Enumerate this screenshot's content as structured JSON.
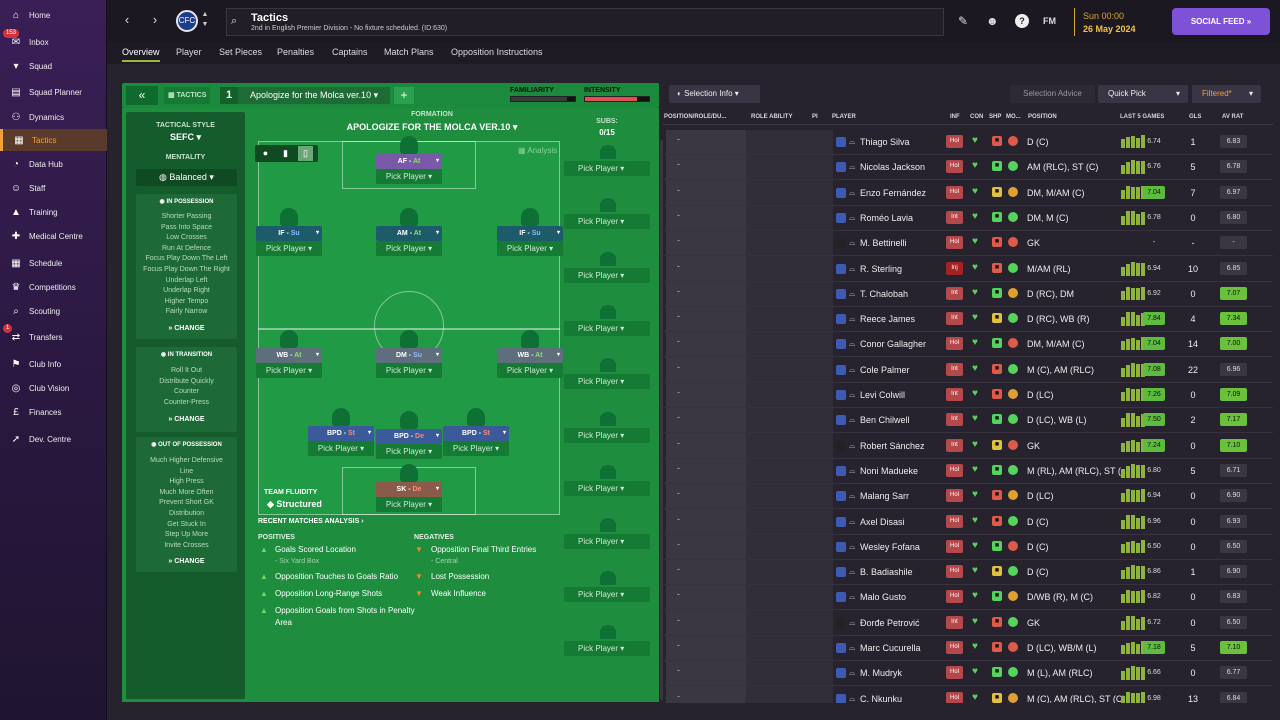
{
  "sidebar": {
    "items": [
      {
        "label": "Home",
        "icon": "home-icon",
        "badge": ""
      },
      {
        "label": "Inbox",
        "icon": "inbox-icon",
        "badge": "153"
      },
      {
        "label": "Squad",
        "icon": "shirt-icon",
        "badge": ""
      },
      {
        "label": "Squad Planner",
        "icon": "planner-icon",
        "badge": ""
      },
      {
        "label": "Dynamics",
        "icon": "dynamics-icon",
        "badge": ""
      },
      {
        "label": "Tactics",
        "icon": "tactics-icon",
        "badge": "",
        "active": true
      },
      {
        "label": "Data Hub",
        "icon": "datahub-icon",
        "badge": ""
      },
      {
        "label": "Staff",
        "icon": "staff-icon",
        "badge": ""
      },
      {
        "label": "Training",
        "icon": "training-icon",
        "badge": ""
      },
      {
        "label": "Medical Centre",
        "icon": "medical-icon",
        "badge": ""
      },
      {
        "label": "Schedule",
        "icon": "calendar-icon",
        "badge": ""
      },
      {
        "label": "Competitions",
        "icon": "trophy-icon",
        "badge": ""
      },
      {
        "label": "Scouting",
        "icon": "scouting-icon",
        "badge": ""
      },
      {
        "label": "Transfers",
        "icon": "transfers-icon",
        "badge": "1"
      },
      {
        "label": "Club Info",
        "icon": "club-info-icon",
        "badge": ""
      },
      {
        "label": "Club Vision",
        "icon": "vision-icon",
        "badge": ""
      },
      {
        "label": "Finances",
        "icon": "finances-icon",
        "badge": ""
      },
      {
        "label": "Dev. Centre",
        "icon": "dev-centre-icon",
        "badge": ""
      }
    ]
  },
  "topbar": {
    "title": "Tactics",
    "subtitle": "2nd in English Premier Division - No fixture scheduled. (ID:630)",
    "club_crest": "CFC",
    "fm_label": "FM",
    "date_time": "Sun 00:00",
    "date": "26 May 2024",
    "social_feed": "SOCIAL FEED"
  },
  "tabs": [
    "Overview",
    "Player",
    "Set Pieces",
    "Penalties",
    "Captains",
    "Match Plans",
    "Opposition Instructions"
  ],
  "tactic": {
    "header_label": "TACTICS",
    "slot_number": "1",
    "name": "Apologize for the Molca ver.10",
    "familiarity_label": "FAMILIARITY",
    "familiarity_level": 0.88,
    "intensity_label": "INTENSITY",
    "intensity_level": 0.82,
    "style_label": "TACTICAL STYLE",
    "style_value": "SEFC",
    "mentality_label": "MENTALITY",
    "mentality_value": "Balanced",
    "in_possession": {
      "title": "IN POSSESSION",
      "items": [
        "Shorter Passing",
        "Pass Into Space",
        "Low Crosses",
        "Run At Defence",
        "Focus Play Down The Left",
        "Focus Play Down The Right",
        "Underlap Left",
        "Underlap Right",
        "Higher Tempo",
        "Fairly Narrow"
      ],
      "change": "CHANGE"
    },
    "in_transition": {
      "title": "IN TRANSITION",
      "items": [
        "Roll It Out",
        "Distribute Quickly",
        "Counter",
        "Counter-Press"
      ],
      "change": "CHANGE"
    },
    "out_of_possession": {
      "title": "OUT OF POSSESSION",
      "items": [
        "Much Higher Defensive",
        "Line",
        "High Press",
        "Much More Often",
        "Prevent Short GK",
        "Distribution",
        "Get Stuck In",
        "Step Up More",
        "Invite Crosses"
      ],
      "change": "CHANGE"
    },
    "formation_label": "FORMATION",
    "formation_name": "APOLOGIZE FOR THE MOLCA VER.10",
    "subs_label": "SUBS:",
    "subs_count": "0/15",
    "analysis_label": "Analysis",
    "pick_player": "Pick Player",
    "positions": [
      {
        "role": "AF",
        "duty": "At",
        "color": "#7a5aa8"
      },
      {
        "role": "IF",
        "duty": "Su",
        "color": "#1d5a6a"
      },
      {
        "role": "AM",
        "duty": "At",
        "color": "#1d5a6a"
      },
      {
        "role": "IF",
        "duty": "Su",
        "color": "#1d5a6a"
      },
      {
        "role": "WB",
        "duty": "At",
        "color": "#5e6e7c"
      },
      {
        "role": "DM",
        "duty": "Su",
        "color": "#5e6e7c"
      },
      {
        "role": "WB",
        "duty": "At",
        "color": "#5e6e7c"
      },
      {
        "role": "BPD",
        "duty": "St",
        "color": "#3a5a9a"
      },
      {
        "role": "BPD",
        "duty": "De",
        "color": "#3a5a9a"
      },
      {
        "role": "BPD",
        "duty": "St",
        "color": "#3a5a9a"
      },
      {
        "role": "SK",
        "duty": "De",
        "color": "#8a5a4a"
      }
    ],
    "team_fluidity_label": "TEAM FLUIDITY",
    "team_fluidity_value": "Structured",
    "recent_matches_label": "RECENT MATCHES ANALYSIS",
    "positives_label": "POSITIVES",
    "positives": [
      "Goals Scored Location",
      "Opposition Touches to Goals Ratio",
      "Opposition Long-Range Shots",
      "Opposition Goals from Shots in Penalty Area"
    ],
    "positives_sub": "- Six Yard Box",
    "negatives_label": "NEGATIVES",
    "negatives": [
      "Opposition Final Third Entries",
      "Lost Possession",
      "Weak Influence"
    ],
    "negatives_sub": "- Central"
  },
  "selection": {
    "selection_info": "Selection Info",
    "selection_advice": "Selection Advice",
    "quick_pick": "Quick Pick",
    "filtered": "Filtered*",
    "headers": [
      "POSITION/ROLE/DU...",
      "ROLE ABILITY",
      "PI",
      "PLAYER",
      "INF",
      "CON",
      "SHP",
      "MO...",
      "POSITION",
      "LAST 5 GAMES",
      "GLS",
      "AV RAT"
    ],
    "players": [
      {
        "name": "Thiago Silva",
        "inf": "Hol",
        "pos": "D (C)",
        "avg": "6.74",
        "gls": "1",
        "rat": "6.83",
        "gk": false
      },
      {
        "name": "Nicolas Jackson",
        "inf": "Hol",
        "pos": "AM (RLC), ST (C)",
        "avg": "6.76",
        "gls": "5",
        "rat": "6.78",
        "gk": false
      },
      {
        "name": "Enzo Fernández",
        "inf": "Hol",
        "pos": "DM, M/AM (C)",
        "avg": "7.04",
        "gls": "7",
        "rat": "6.97",
        "gk": false
      },
      {
        "name": "Roméo Lavia",
        "inf": "Int",
        "pos": "DM, M (C)",
        "avg": "6.78",
        "gls": "0",
        "rat": "6.80",
        "gk": false
      },
      {
        "name": "M. Bettinelli",
        "inf": "Hol",
        "pos": "GK",
        "avg": "-",
        "gls": "-",
        "rat": "-",
        "gk": true
      },
      {
        "name": "R. Sterling",
        "inf": "Inj",
        "pos": "M/AM (RL)",
        "avg": "6.94",
        "gls": "10",
        "rat": "6.85",
        "gk": false
      },
      {
        "name": "T. Chalobah",
        "inf": "Int",
        "pos": "D (RC), DM",
        "avg": "6.92",
        "gls": "0",
        "rat": "7.07",
        "gk": false
      },
      {
        "name": "Reece James",
        "inf": "Int",
        "pos": "D (RC), WB (R)",
        "avg": "7.84",
        "gls": "4",
        "rat": "7.34",
        "gk": false
      },
      {
        "name": "Conor Gallagher",
        "inf": "Hol",
        "pos": "DM, M/AM (C)",
        "avg": "7.04",
        "gls": "14",
        "rat": "7.00",
        "gk": false
      },
      {
        "name": "Cole Palmer",
        "inf": "Int",
        "pos": "M (C), AM (RLC)",
        "avg": "7.08",
        "gls": "22",
        "rat": "6.96",
        "gk": false
      },
      {
        "name": "Levi Colwill",
        "inf": "Int",
        "pos": "D (LC)",
        "avg": "7.26",
        "gls": "0",
        "rat": "7.09",
        "gk": false
      },
      {
        "name": "Ben Chilwell",
        "inf": "Int",
        "pos": "D (LC), WB (L)",
        "avg": "7.50",
        "gls": "2",
        "rat": "7.17",
        "gk": false
      },
      {
        "name": "Robert Sánchez",
        "inf": "Int",
        "pos": "GK",
        "avg": "7.24",
        "gls": "0",
        "rat": "7.10",
        "gk": true
      },
      {
        "name": "Noni Madueke",
        "inf": "Hol",
        "pos": "M (RL), AM (RLC), ST (...",
        "avg": "6.80",
        "gls": "5",
        "rat": "6.71",
        "gk": false
      },
      {
        "name": "Malang Sarr",
        "inf": "Hol",
        "pos": "D (LC)",
        "avg": "6.94",
        "gls": "0",
        "rat": "6.90",
        "gk": false
      },
      {
        "name": "Axel Disasi",
        "inf": "Hol",
        "pos": "D (C)",
        "avg": "6.96",
        "gls": "0",
        "rat": "6.93",
        "gk": false
      },
      {
        "name": "Wesley Fofana",
        "inf": "Hol",
        "pos": "D (C)",
        "avg": "6.50",
        "gls": "0",
        "rat": "6.50",
        "gk": false
      },
      {
        "name": "B. Badiashile",
        "inf": "Hol",
        "pos": "D (C)",
        "avg": "6.86",
        "gls": "1",
        "rat": "6.90",
        "gk": false
      },
      {
        "name": "Malo Gusto",
        "inf": "Hol",
        "pos": "D/WB (R), M (C)",
        "avg": "6.82",
        "gls": "0",
        "rat": "6.83",
        "gk": false
      },
      {
        "name": "Đorđe Petrović",
        "inf": "Int",
        "pos": "GK",
        "avg": "6.72",
        "gls": "0",
        "rat": "6.50",
        "gk": true
      },
      {
        "name": "Marc Cucurella",
        "inf": "Hol",
        "pos": "D (LC), WB/M (L)",
        "avg": "7.18",
        "gls": "5",
        "rat": "7.10",
        "gk": false
      },
      {
        "name": "M. Mudryk",
        "inf": "Hol",
        "pos": "M (L), AM (RLC)",
        "avg": "6.66",
        "gls": "0",
        "rat": "6.77",
        "gk": false
      },
      {
        "name": "C. Nkunku",
        "inf": "Hol",
        "pos": "M (C), AM (RLC), ST (C)",
        "avg": "6.98",
        "gls": "13",
        "rat": "6.84",
        "gk": false
      }
    ]
  }
}
